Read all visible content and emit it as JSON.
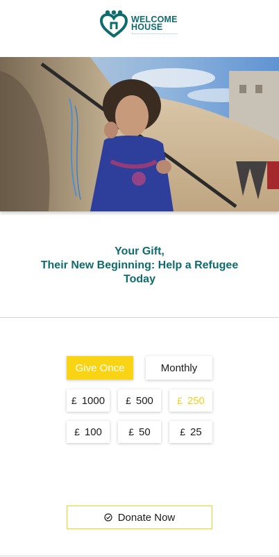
{
  "brand": {
    "name_line1": "WELCOME",
    "name_line2": "HOUSE",
    "logo_icon": "family-heart-icon",
    "color": "#0e6b6e"
  },
  "hero": {
    "image": "refugee-child-photo"
  },
  "headline": {
    "line1": "Your Gift,",
    "line2": "Their New Beginning: Help a Refugee Today"
  },
  "frequency": {
    "once_label": "Give Once",
    "monthly_label": "Monthly",
    "selected": "once"
  },
  "amounts": {
    "currency": "£",
    "options": [
      "1000",
      "500",
      "250",
      "100",
      "50",
      "25"
    ],
    "selected": "250"
  },
  "cta": {
    "label": "Donate Now",
    "icon": "check-circle-icon"
  },
  "colors": {
    "accent": "#f8d414",
    "teal": "#0e6b6e"
  }
}
